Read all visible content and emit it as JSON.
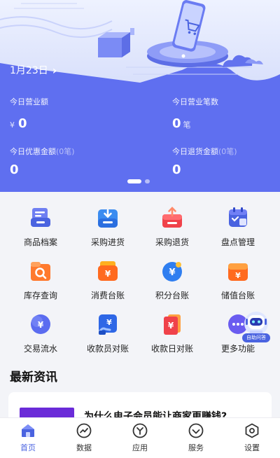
{
  "hero": {
    "date": "1月23日",
    "stats": [
      {
        "label": "今日营业额",
        "sub": "",
        "currency": "¥",
        "value": "0",
        "unit": ""
      },
      {
        "label": "今日营业笔数",
        "sub": "",
        "currency": "",
        "value": "0",
        "unit": "笔"
      },
      {
        "label": "今日优惠金额",
        "sub": "(0笔)",
        "currency": "",
        "value": "0",
        "unit": ""
      },
      {
        "label": "今日退货金额",
        "sub": "(0笔)",
        "currency": "",
        "value": "0",
        "unit": ""
      }
    ]
  },
  "menu": [
    {
      "label": "商品档案",
      "icon": "product-archive-icon"
    },
    {
      "label": "采购进货",
      "icon": "purchase-in-icon"
    },
    {
      "label": "采购退货",
      "icon": "purchase-return-icon"
    },
    {
      "label": "盘点管理",
      "icon": "stocktake-icon"
    },
    {
      "label": "库存查询",
      "icon": "inventory-search-icon"
    },
    {
      "label": "消费台账",
      "icon": "consumption-ledger-icon"
    },
    {
      "label": "积分台账",
      "icon": "points-ledger-icon"
    },
    {
      "label": "储值台账",
      "icon": "stored-value-ledger-icon"
    },
    {
      "label": "交易流水",
      "icon": "transaction-flow-icon"
    },
    {
      "label": "收款员对账",
      "icon": "cashier-reconcile-icon"
    },
    {
      "label": "收款日对账",
      "icon": "daily-reconcile-icon"
    },
    {
      "label": "更多功能",
      "icon": "more-icon"
    }
  ],
  "assistant": {
    "label": "自助问答"
  },
  "news": {
    "title": "最新资讯",
    "items": [
      {
        "title": "为什么电子会员能让商家更赚钱?"
      }
    ]
  },
  "tabbar": {
    "active": "首页",
    "tabs": [
      {
        "label": "首页",
        "icon": "home-icon"
      },
      {
        "label": "数据",
        "icon": "data-chart-icon"
      },
      {
        "label": "应用",
        "icon": "apps-icon"
      },
      {
        "label": "服务",
        "icon": "service-icon"
      },
      {
        "label": "设置",
        "icon": "settings-icon"
      }
    ]
  },
  "colors": {
    "brand": "#5f6ff0",
    "accent_blue": "#4a63e0",
    "accent_red": "#f0424a",
    "accent_orange": "#ff7a2e",
    "news_thumb": "#6a2bd8"
  }
}
